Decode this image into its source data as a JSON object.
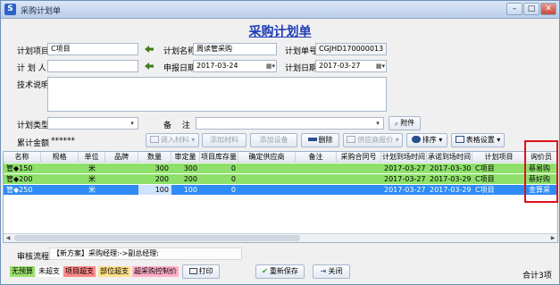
{
  "window": {
    "title": "采购计划单",
    "minimize": "–",
    "maximize": "□",
    "close": "✕"
  },
  "form": {
    "title": "采购计划单",
    "project_label": "计划项目",
    "project_value": "C项目",
    "plan_name_label": "计划名称",
    "plan_name_value": "周读管采购",
    "plan_no_label": "计划单号",
    "plan_no_value": "CGJHD170000013",
    "planner_label": "计 划 人",
    "planner_value": "",
    "report_date_label": "申报日期",
    "report_date_value": "2017-03-24",
    "plan_date_label": "计划日期",
    "plan_date_value": "2017-03-27",
    "tech_label": "技术说明",
    "tech_value": "",
    "type_label": "计划类型",
    "type_value": "",
    "remark_label": "备　 注",
    "remark_value": "",
    "attach_label": "附件",
    "total_label": "累计金额",
    "total_value": "******"
  },
  "toolbar": {
    "import_label": "调入材料 ▾",
    "add_material_label": "添加材料",
    "add_equipment_label": "添加设备",
    "delete_label": "删除",
    "supplier_price_label": "供应商报价 ▾",
    "sort_label": "排序 ▾",
    "table_settings_label": "表格设置 ▾"
  },
  "grid": {
    "headers": [
      "名称",
      "规格",
      "单位",
      "品牌",
      "数量",
      "审定量",
      "项目库存量",
      "确定供应商",
      "备注",
      "采购合同号",
      "计划到场时间",
      "承诺到场时间",
      "计划项目",
      "询价员"
    ],
    "rows": [
      {
        "name": "管◆150",
        "spec": "",
        "unit": "米",
        "brand": "",
        "qty": "300",
        "approved": "300",
        "stock": "0",
        "supplier": "",
        "remark": "",
        "contract": "",
        "plan_arrival": "2017-03-27",
        "promise_arrival": "2017-03-30",
        "project": "C项目",
        "inquirer": "蔡易购",
        "style": "green"
      },
      {
        "name": "管◆200",
        "spec": "",
        "unit": "米",
        "brand": "",
        "qty": "200",
        "approved": "200",
        "stock": "0",
        "supplier": "",
        "remark": "",
        "contract": "",
        "plan_arrival": "2017-03-27",
        "promise_arrival": "2017-03-29",
        "project": "C项目",
        "inquirer": "蔡好购",
        "style": "green"
      },
      {
        "name": "管◆250",
        "spec": "",
        "unit": "米",
        "brand": "",
        "qty": "100",
        "approved": "100",
        "stock": "0",
        "supplier": "",
        "remark": "",
        "contract": "",
        "plan_arrival": "2017-03-27",
        "promise_arrival": "2017-03-29",
        "project": "C项目",
        "inquirer": "金算采",
        "style": "selected"
      }
    ]
  },
  "approval": {
    "label": "审核流程",
    "value": "【新方案】采购经理:->副总经理:"
  },
  "legend": [
    {
      "label": "无预算",
      "color": "#9be06a"
    },
    {
      "label": "未超支",
      "color": "#ffffff"
    },
    {
      "label": "项目超支",
      "color": "#ff8a8a"
    },
    {
      "label": "部位超支",
      "color": "#ffe08a"
    },
    {
      "label": "超采购控制价",
      "color": "#ffb0c8"
    }
  ],
  "buttons": {
    "print_label": "打印",
    "resave_label": "重新保存",
    "close_label": "关闭"
  },
  "status": {
    "total": "合计3项"
  },
  "colors": {
    "green_row": "#8ee06a",
    "selected_row": "#2f8bf5",
    "title_blue": "#1d3bb5",
    "highlight": "#e0101a"
  }
}
